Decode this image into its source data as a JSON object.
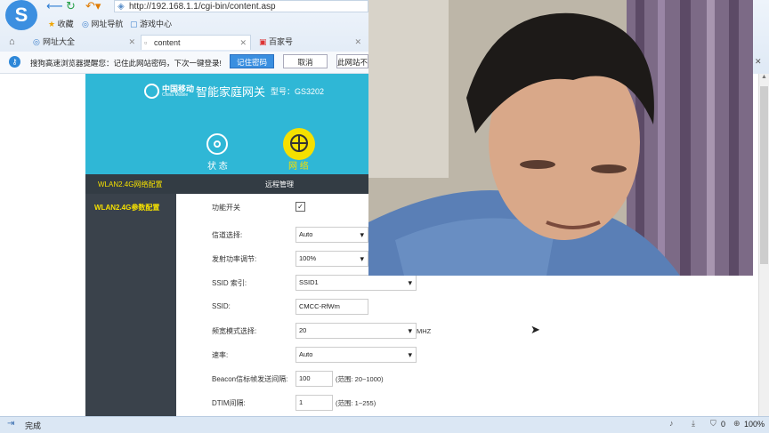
{
  "browser": {
    "address": "http://192.168.1.1/cgi-bin/content.asp",
    "favorites": [
      {
        "label": "收藏",
        "icon": "star-icon"
      },
      {
        "label": "网址导航",
        "icon": "globe-icon"
      },
      {
        "label": "游戏中心",
        "icon": "game-icon"
      }
    ],
    "tabs": [
      {
        "label": "网址大全"
      },
      {
        "label": "content"
      },
      {
        "label": "百家号"
      }
    ],
    "notice": {
      "text": "搜狗高速浏览器提醒您：记住此网站密码，下次一键登录!",
      "remember": "记住密码",
      "cancel": "取消",
      "never": "此网站不"
    }
  },
  "router": {
    "brand": "中国移动",
    "brand_en": "China Mobile",
    "product": "智能家庭网关",
    "model": "型号：GS3202",
    "nav": [
      {
        "label": "状 态",
        "icon": "status-icon"
      },
      {
        "label": "网 络",
        "icon": "network-globe-icon"
      }
    ],
    "subnav": [
      "WLAN2.4G网络配置",
      "远程管理"
    ],
    "sidebar_item": "WLAN2.4G参数配置",
    "form": {
      "rows": [
        {
          "label": "功能开关",
          "type": "checkbox",
          "checked": true
        },
        {
          "label": "信道选择:",
          "type": "select",
          "value": "Auto"
        },
        {
          "label": "发射功率调节:",
          "type": "select",
          "value": "100%"
        },
        {
          "label": "SSID 索引:",
          "type": "select",
          "value": "SSID1"
        },
        {
          "label": "SSID:",
          "type": "text",
          "value": "CMCC-RfWm"
        },
        {
          "label": "频宽模式选择:",
          "type": "select",
          "value": "20",
          "suffix": "MHZ"
        },
        {
          "label": "速率:",
          "type": "select",
          "value": "Auto"
        },
        {
          "label": "Beacon信标帧发送间隔:",
          "type": "text",
          "value": "100",
          "suffix": "(范围: 20~1000)"
        },
        {
          "label": "DTIM间隔:",
          "type": "text",
          "value": "1",
          "suffix": "(范围: 1~255)"
        }
      ]
    }
  },
  "statusbar": {
    "text": "完成",
    "zoom": "100%",
    "count": "0"
  },
  "colors": {
    "header": "#2fb7d6",
    "accent": "#f5e000",
    "dark": "#333c44"
  }
}
